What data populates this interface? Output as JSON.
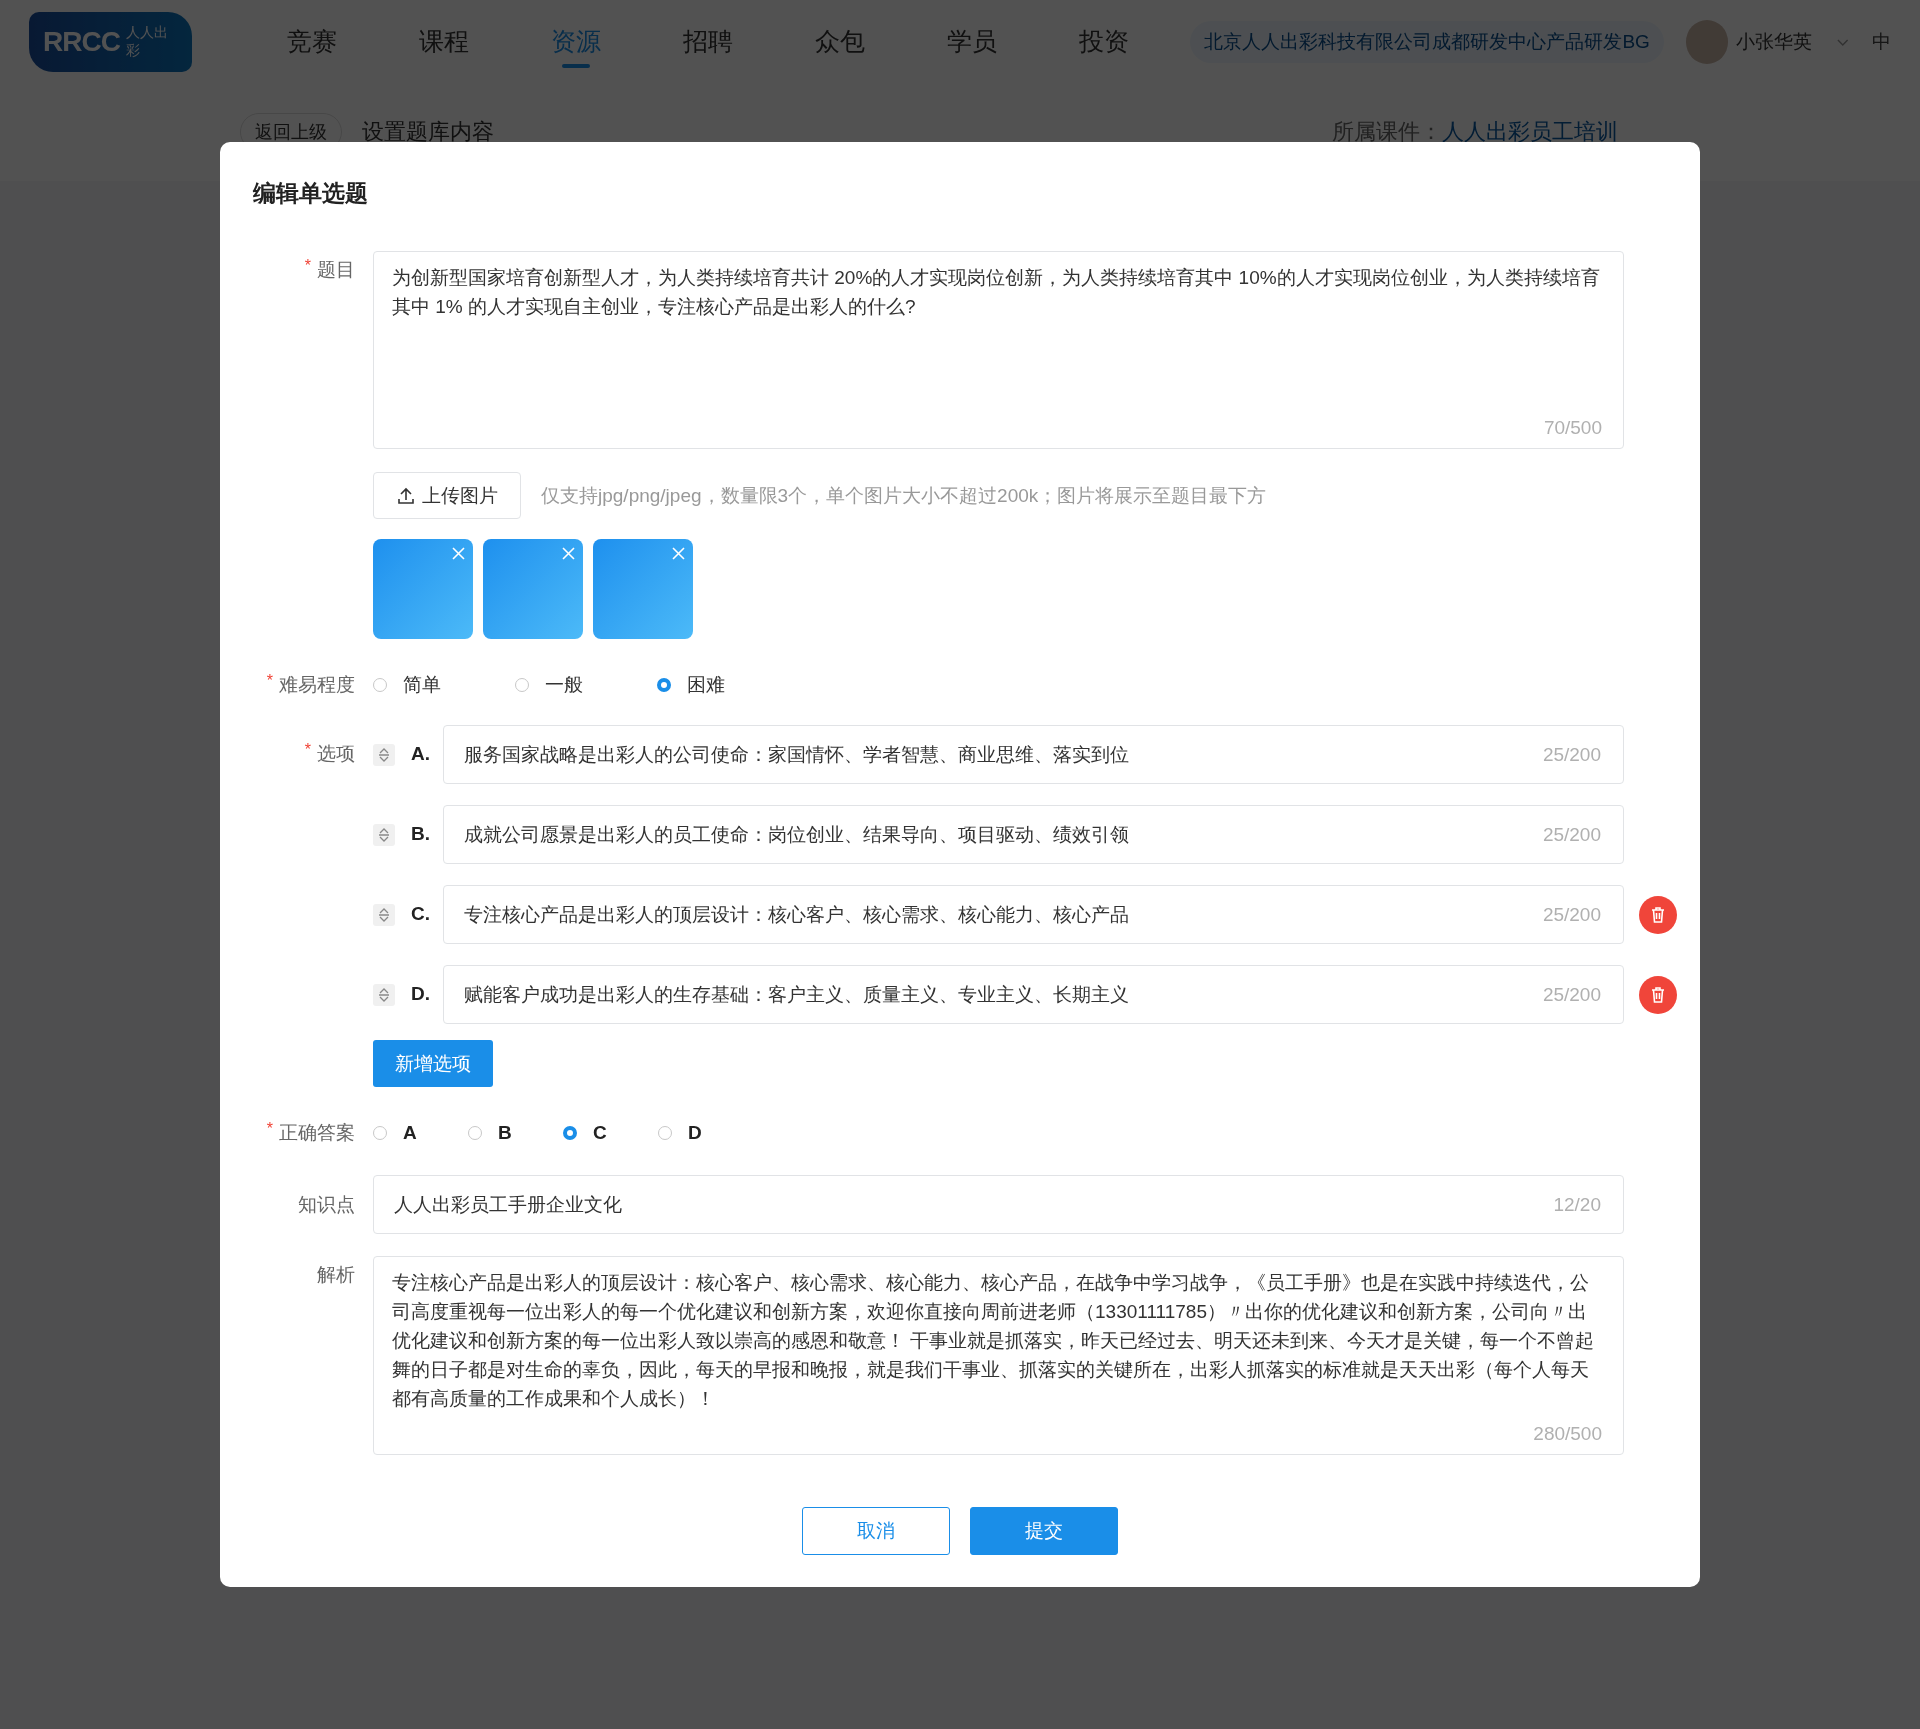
{
  "nav": {
    "logo": {
      "text": "RRCC",
      "subtitle": "人人出彩"
    },
    "items": [
      {
        "label": "竞赛",
        "selected": false
      },
      {
        "label": "课程",
        "selected": false
      },
      {
        "label": "资源",
        "selected": true
      },
      {
        "label": "招聘",
        "selected": false
      },
      {
        "label": "众包",
        "selected": false
      },
      {
        "label": "学员",
        "selected": false
      },
      {
        "label": "投资",
        "selected": false
      }
    ],
    "org": "北京人人出彩科技有限公司成都研发中心产品研发BG",
    "user": "小张华英",
    "language": "中"
  },
  "subbar": {
    "back_button": "返回上级",
    "title": "设置题库内容",
    "courseware_label": "所属课件：",
    "courseware": "人人出彩员工培训"
  },
  "modal": {
    "title": "编辑单选题",
    "question": {
      "required_mark": "*",
      "label": "题目",
      "value": "为创新型国家培育创新型人才，为人类持续培育共计 20%的人才实现岗位创新，为人类持续培育其中 10%的人才实现岗位创业，为人类持续培育其中 1% 的人才实现自主创业，专注核心产品是出彩人的什么?",
      "count": "70/500"
    },
    "upload": {
      "button": "上传图片",
      "hint": "仅支持jpg/png/jpeg，数量限3个，单个图片大小不超过200k；图片将展示至题目最下方"
    },
    "thumbnails": [
      {
        "kind": "image"
      },
      {
        "kind": "image"
      },
      {
        "kind": "image"
      }
    ],
    "difficulty": {
      "required_mark": "*",
      "label": "难易程度",
      "options": [
        {
          "label": "简单",
          "selected": false
        },
        {
          "label": "一般",
          "selected": false
        },
        {
          "label": "困难",
          "selected": true
        }
      ]
    },
    "options": {
      "required_mark": "*",
      "label": "选项",
      "items": [
        {
          "letter": "A.",
          "text": "服务国家战略是出彩人的公司使命：家国情怀、学者智慧、商业思维、落实到位",
          "count": "25/200",
          "deletable": false
        },
        {
          "letter": "B.",
          "text": "成就公司愿景是出彩人的员工使命：岗位创业、结果导向、项目驱动、绩效引领",
          "count": "25/200",
          "deletable": false
        },
        {
          "letter": "C.",
          "text": "专注核心产品是出彩人的顶层设计：核心客户、核心需求、核心能力、核心产品",
          "count": "25/200",
          "deletable": true
        },
        {
          "letter": "D.",
          "text": "赋能客户成功是出彩人的生存基础：客户主义、质量主义、专业主义、长期主义",
          "count": "25/200",
          "deletable": true
        }
      ],
      "add_button": "新增选项"
    },
    "answer": {
      "required_mark": "*",
      "label": "正确答案",
      "options": [
        {
          "label": "A",
          "selected": false
        },
        {
          "label": "B",
          "selected": false
        },
        {
          "label": "C",
          "selected": true
        },
        {
          "label": "D",
          "selected": false
        }
      ]
    },
    "knowledge": {
      "label": "知识点",
      "value": "人人出彩员工手册企业文化",
      "count": "12/20"
    },
    "analysis": {
      "label": "解析",
      "value": "专注核心产品是出彩人的顶层设计：核心客户、核心需求、核心能力、核心产品，在战争中学习战争，《员工手册》也是在实践中持续迭代，公司高度重视每一位出彩人的每一个优化建议和创新方案，欢迎你直接向周前进老师（13301111785）〃出你的优化建议和创新方案，公司向〃出优化建议和创新方案的每一位出彩人致以崇高的感恩和敬意！ 干事业就是抓落实，昨天已经过去、明天还未到来、今天才是关键，每一个不曾起舞的日子都是对生命的辜负，因此，每天的早报和晚报，就是我们干事业、抓落实的关键所在，出彩人抓落实的标准就是天天出彩（每个人每天都有高质量的工作成果和个人成长）！",
      "count": "280/500"
    },
    "buttons": {
      "cancel": "取消",
      "submit": "提交"
    }
  }
}
